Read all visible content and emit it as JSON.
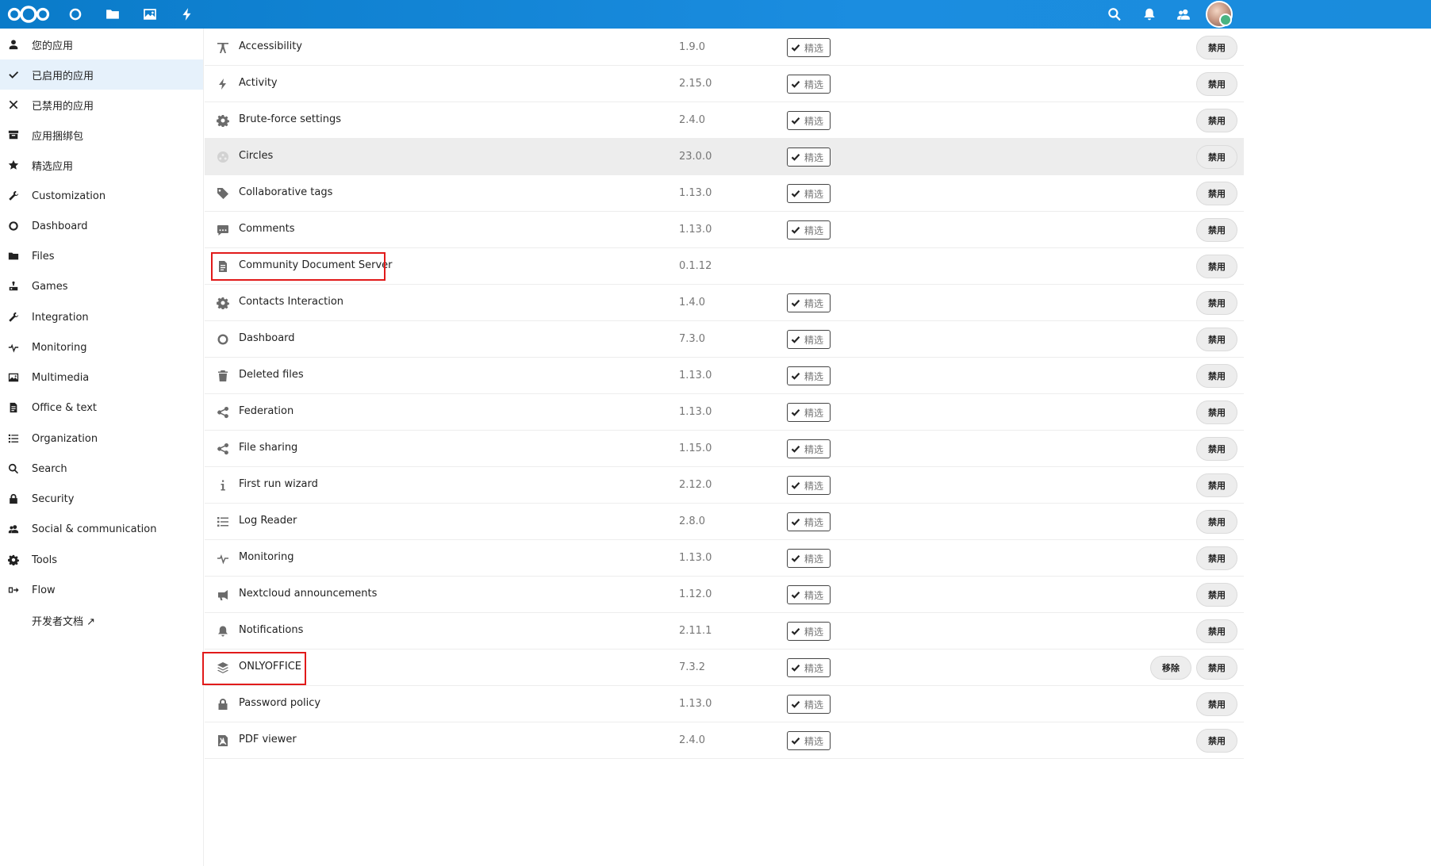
{
  "header": {
    "icons": [
      "nextcloud-logo",
      "dashboard-icon",
      "files-icon",
      "photos-icon",
      "activity-icon",
      "search-icon",
      "notifications-icon",
      "contacts-icon",
      "user-avatar"
    ]
  },
  "sidebar": {
    "items": [
      {
        "label": "您的应用",
        "icon": "user-icon"
      },
      {
        "label": "已启用的应用",
        "icon": "check-icon",
        "active": true
      },
      {
        "label": "已禁用的应用",
        "icon": "close-icon"
      },
      {
        "label": "应用捆绑包",
        "icon": "archive-icon"
      },
      {
        "label": "精选应用",
        "icon": "star-icon"
      },
      {
        "label": "Customization",
        "icon": "wrench-icon"
      },
      {
        "label": "Dashboard",
        "icon": "circle-icon"
      },
      {
        "label": "Files",
        "icon": "folder-icon"
      },
      {
        "label": "Games",
        "icon": "joystick-icon"
      },
      {
        "label": "Integration",
        "icon": "wrench-icon"
      },
      {
        "label": "Monitoring",
        "icon": "pulse-icon"
      },
      {
        "label": "Multimedia",
        "icon": "image-icon"
      },
      {
        "label": "Office & text",
        "icon": "document-icon"
      },
      {
        "label": "Organization",
        "icon": "list-icon"
      },
      {
        "label": "Search",
        "icon": "search-icon"
      },
      {
        "label": "Security",
        "icon": "lock-icon"
      },
      {
        "label": "Social & communication",
        "icon": "group-icon"
      },
      {
        "label": "Tools",
        "icon": "gear-icon"
      },
      {
        "label": "Flow",
        "icon": "flow-icon"
      },
      {
        "label": "开发者文档 ↗",
        "icon": ""
      }
    ]
  },
  "apps": [
    {
      "name": "Accessibility",
      "version": "1.9.0",
      "featured": true,
      "icon": "accessibility-icon"
    },
    {
      "name": "Activity",
      "version": "2.15.0",
      "featured": true,
      "icon": "activity-icon"
    },
    {
      "name": "Brute-force settings",
      "version": "2.4.0",
      "featured": true,
      "icon": "gear-icon"
    },
    {
      "name": "Circles",
      "version": "23.0.0",
      "featured": true,
      "icon": "circles-icon",
      "hovered": true
    },
    {
      "name": "Collaborative tags",
      "version": "1.13.0",
      "featured": true,
      "icon": "tag-icon"
    },
    {
      "name": "Comments",
      "version": "1.13.0",
      "featured": true,
      "icon": "comment-icon"
    },
    {
      "name": "Community Document Server",
      "version": "0.1.12",
      "featured": false,
      "icon": "document-icon",
      "highlighted": true
    },
    {
      "name": "Contacts Interaction",
      "version": "1.4.0",
      "featured": true,
      "icon": "gear-icon"
    },
    {
      "name": "Dashboard",
      "version": "7.3.0",
      "featured": true,
      "icon": "circle-icon"
    },
    {
      "name": "Deleted files",
      "version": "1.13.0",
      "featured": true,
      "icon": "trash-icon"
    },
    {
      "name": "Federation",
      "version": "1.13.0",
      "featured": true,
      "icon": "share-icon"
    },
    {
      "name": "File sharing",
      "version": "1.15.0",
      "featured": true,
      "icon": "share-icon"
    },
    {
      "name": "First run wizard",
      "version": "2.12.0",
      "featured": true,
      "icon": "info-icon"
    },
    {
      "name": "Log Reader",
      "version": "2.8.0",
      "featured": true,
      "icon": "list-icon"
    },
    {
      "name": "Monitoring",
      "version": "1.13.0",
      "featured": true,
      "icon": "pulse-icon"
    },
    {
      "name": "Nextcloud announcements",
      "version": "1.12.0",
      "featured": true,
      "icon": "megaphone-icon"
    },
    {
      "name": "Notifications",
      "version": "2.11.1",
      "featured": true,
      "icon": "bell-icon"
    },
    {
      "name": "ONLYOFFICE",
      "version": "7.3.2",
      "featured": true,
      "icon": "layers-icon",
      "highlighted": true,
      "removable": true
    },
    {
      "name": "Password policy",
      "version": "1.13.0",
      "featured": true,
      "icon": "lock-icon"
    },
    {
      "name": "PDF viewer",
      "version": "2.4.0",
      "featured": true,
      "icon": "pdf-icon"
    }
  ],
  "labels": {
    "featured": "精选",
    "disable": "禁用",
    "remove": "移除"
  }
}
